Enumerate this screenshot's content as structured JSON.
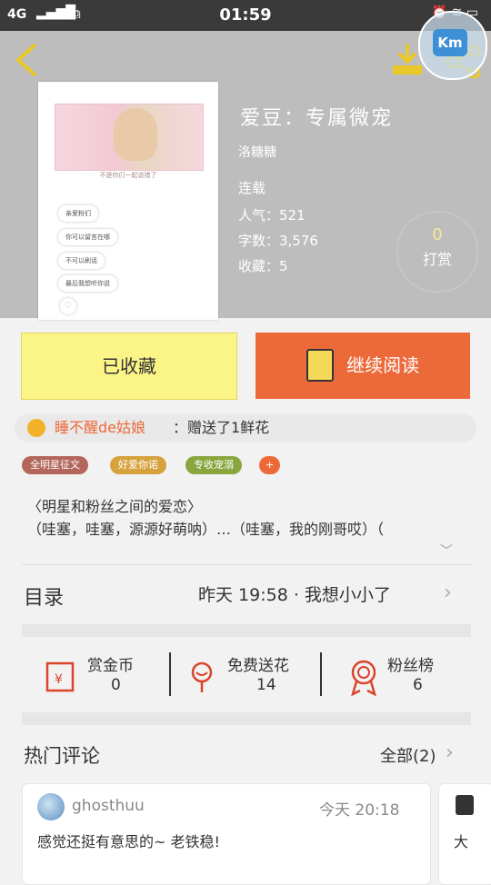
{
  "status": {
    "signal": "4G",
    "time": "01:59"
  },
  "book": {
    "title": "爱豆：专属微宠",
    "author": "洛糖糖",
    "state": "连载",
    "popularity": "人气：521",
    "words": "字数：3,576",
    "favorites": "收藏：5",
    "tip_count": "0",
    "tip_label": "打赏"
  },
  "cover": {
    "caption": "不是你们一起说错了",
    "bubbles": [
      "亲爱粉们",
      "你可以留言在哪",
      "不可以刷话",
      "最后我想听你说"
    ]
  },
  "buttons": {
    "collected": "已收藏",
    "continue": "继续阅读"
  },
  "flower": {
    "user": "睡不醒de姑娘",
    "text": "：赠送了1鲜花"
  },
  "tags": [
    "全明星征文",
    "好爱你诺",
    "专收宠溺",
    "+"
  ],
  "description": {
    "line1": "〈明星和粉丝之间的爱恋〉",
    "line2": "（哇塞，哇塞，源源好萌呐）…（哇塞，我的刚哥哎）（"
  },
  "toc": {
    "label": "目录",
    "latest": "昨天 19:58 · 我想小小了"
  },
  "stats": [
    {
      "label": "赏金币",
      "value": "0"
    },
    {
      "label": "免费送花",
      "value": "14"
    },
    {
      "label": "粉丝榜",
      "value": "6"
    }
  ],
  "hot": {
    "title": "热门评论",
    "all": "全部(2)"
  },
  "comment": {
    "user": "ghosthuu",
    "time": "今天 20:18",
    "text": "感觉还挺有意思的~ 老铁稳!"
  },
  "comment2": {
    "text": "大"
  },
  "overlay": {
    "label": "Km"
  }
}
